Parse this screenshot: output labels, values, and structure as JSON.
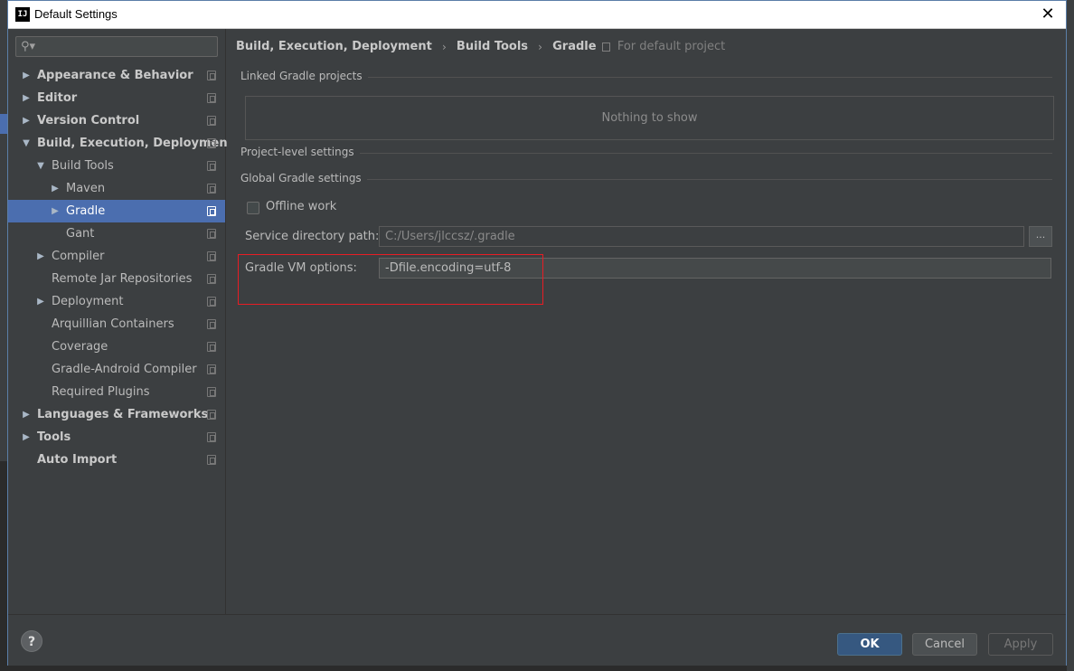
{
  "window": {
    "title": "Default Settings",
    "app_icon": "IJ",
    "close_glyph": "✕"
  },
  "sidebar": {
    "search_placeholder": "",
    "items": [
      {
        "label": "Appearance & Behavior",
        "level": 0,
        "arrow": "right",
        "bold": true
      },
      {
        "label": "Editor",
        "level": 0,
        "arrow": "right",
        "bold": true
      },
      {
        "label": "Version Control",
        "level": 0,
        "arrow": "right",
        "bold": true
      },
      {
        "label": "Build, Execution, Deployment",
        "level": 0,
        "arrow": "down",
        "bold": true
      },
      {
        "label": "Build Tools",
        "level": 1,
        "arrow": "down",
        "bold": false
      },
      {
        "label": "Maven",
        "level": 2,
        "arrow": "right",
        "bold": false
      },
      {
        "label": "Gradle",
        "level": 2,
        "arrow": "right",
        "bold": false,
        "selected": true
      },
      {
        "label": "Gant",
        "level": 2,
        "arrow": "none",
        "bold": false
      },
      {
        "label": "Compiler",
        "level": 1,
        "arrow": "right",
        "bold": false
      },
      {
        "label": "Remote Jar Repositories",
        "level": 1,
        "arrow": "none",
        "bold": false
      },
      {
        "label": "Deployment",
        "level": 1,
        "arrow": "right",
        "bold": false
      },
      {
        "label": "Arquillian Containers",
        "level": 1,
        "arrow": "none",
        "bold": false
      },
      {
        "label": "Coverage",
        "level": 1,
        "arrow": "none",
        "bold": false
      },
      {
        "label": "Gradle-Android Compiler",
        "level": 1,
        "arrow": "none",
        "bold": false
      },
      {
        "label": "Required Plugins",
        "level": 1,
        "arrow": "none",
        "bold": false
      },
      {
        "label": "Languages & Frameworks",
        "level": 0,
        "arrow": "right",
        "bold": true
      },
      {
        "label": "Tools",
        "level": 0,
        "arrow": "right",
        "bold": true
      },
      {
        "label": "Auto Import",
        "level": 0,
        "arrow": "none",
        "bold": true
      }
    ]
  },
  "breadcrumb": {
    "crumbs": [
      "Build, Execution, Deployment",
      "Build Tools",
      "Gradle"
    ],
    "separator": "›",
    "note": "For default project"
  },
  "main": {
    "linked_section": "Linked Gradle projects",
    "empty_text": "Nothing to show",
    "project_section": "Project-level settings",
    "global_section": "Global Gradle settings",
    "offline_label": "Offline work",
    "offline_checked": false,
    "service_dir_label": "Service directory path:",
    "service_dir_value": "C:/Users/jlccsz/.gradle",
    "browse_label": "...",
    "vm_options_label": "Gradle VM options:",
    "vm_options_value": "-Dfile.encoding=utf-8",
    "highlight_color": "#e81c24"
  },
  "footer": {
    "help_label": "?",
    "ok_label": "OK",
    "cancel_label": "Cancel",
    "apply_label": "Apply"
  },
  "colors": {
    "background": "#3c3f41",
    "selection": "#4b6eaf",
    "ok_button": "#365880"
  }
}
